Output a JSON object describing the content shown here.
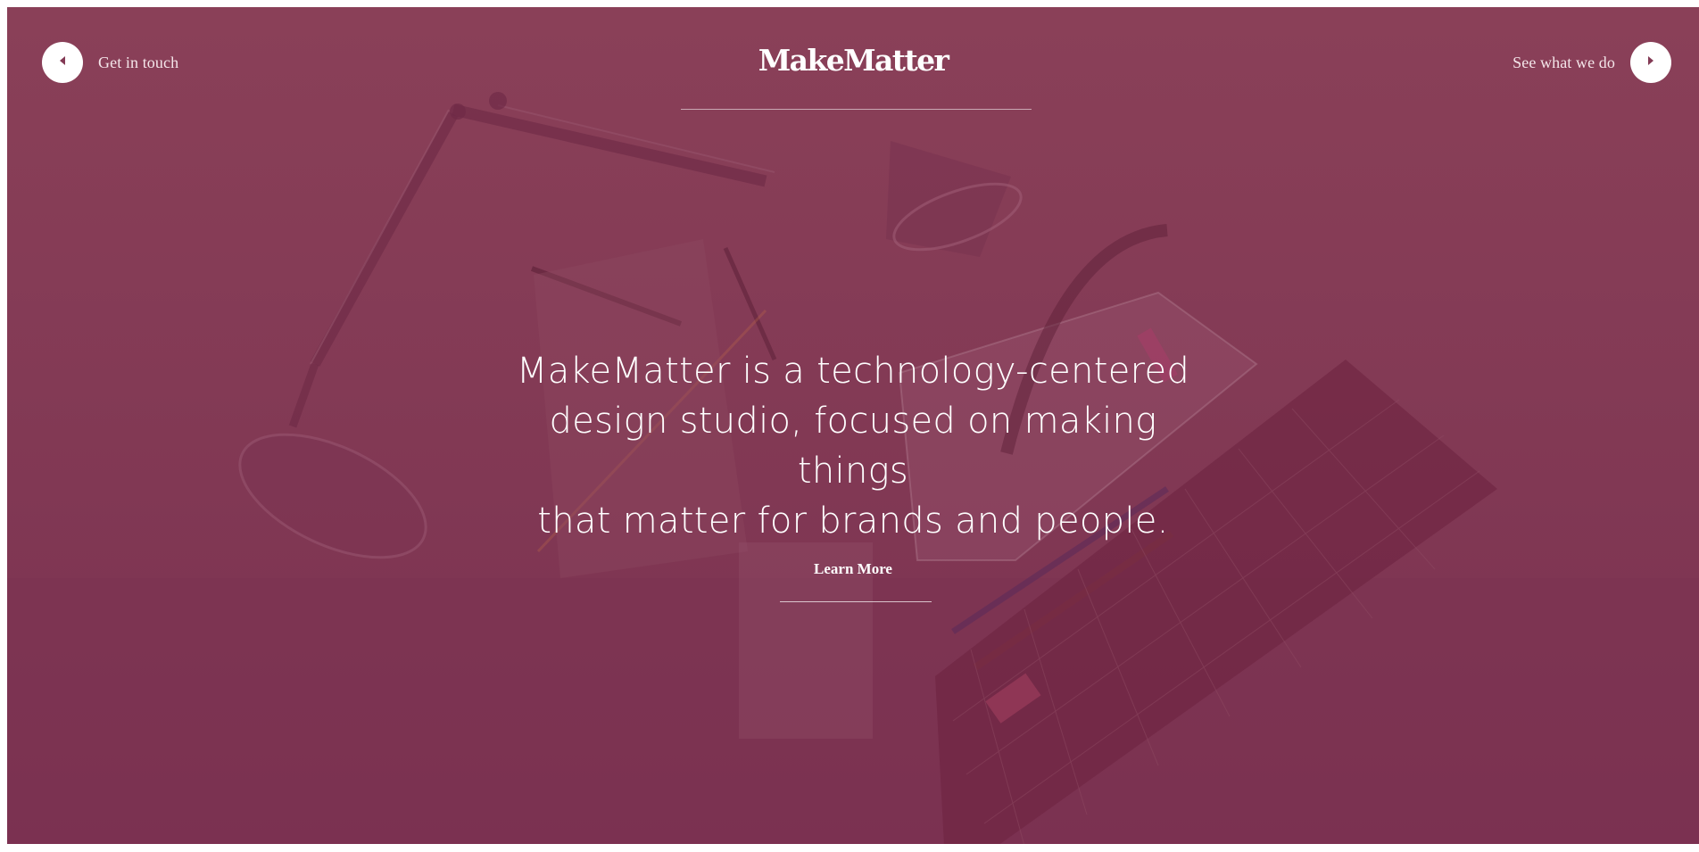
{
  "header": {
    "logo": "MakeMatter",
    "left_link": "Get in touch",
    "right_link": "See what we do"
  },
  "hero": {
    "line1": "MakeMatter is a technology-centered",
    "line2": "design studio, focused on making things",
    "line3": "that matter for brands and people.",
    "cta": "Learn More"
  },
  "colors": {
    "overlay": "#833a55",
    "text": "#ffffff"
  },
  "icons": {
    "left": "caret-left-icon",
    "right": "caret-right-icon"
  }
}
